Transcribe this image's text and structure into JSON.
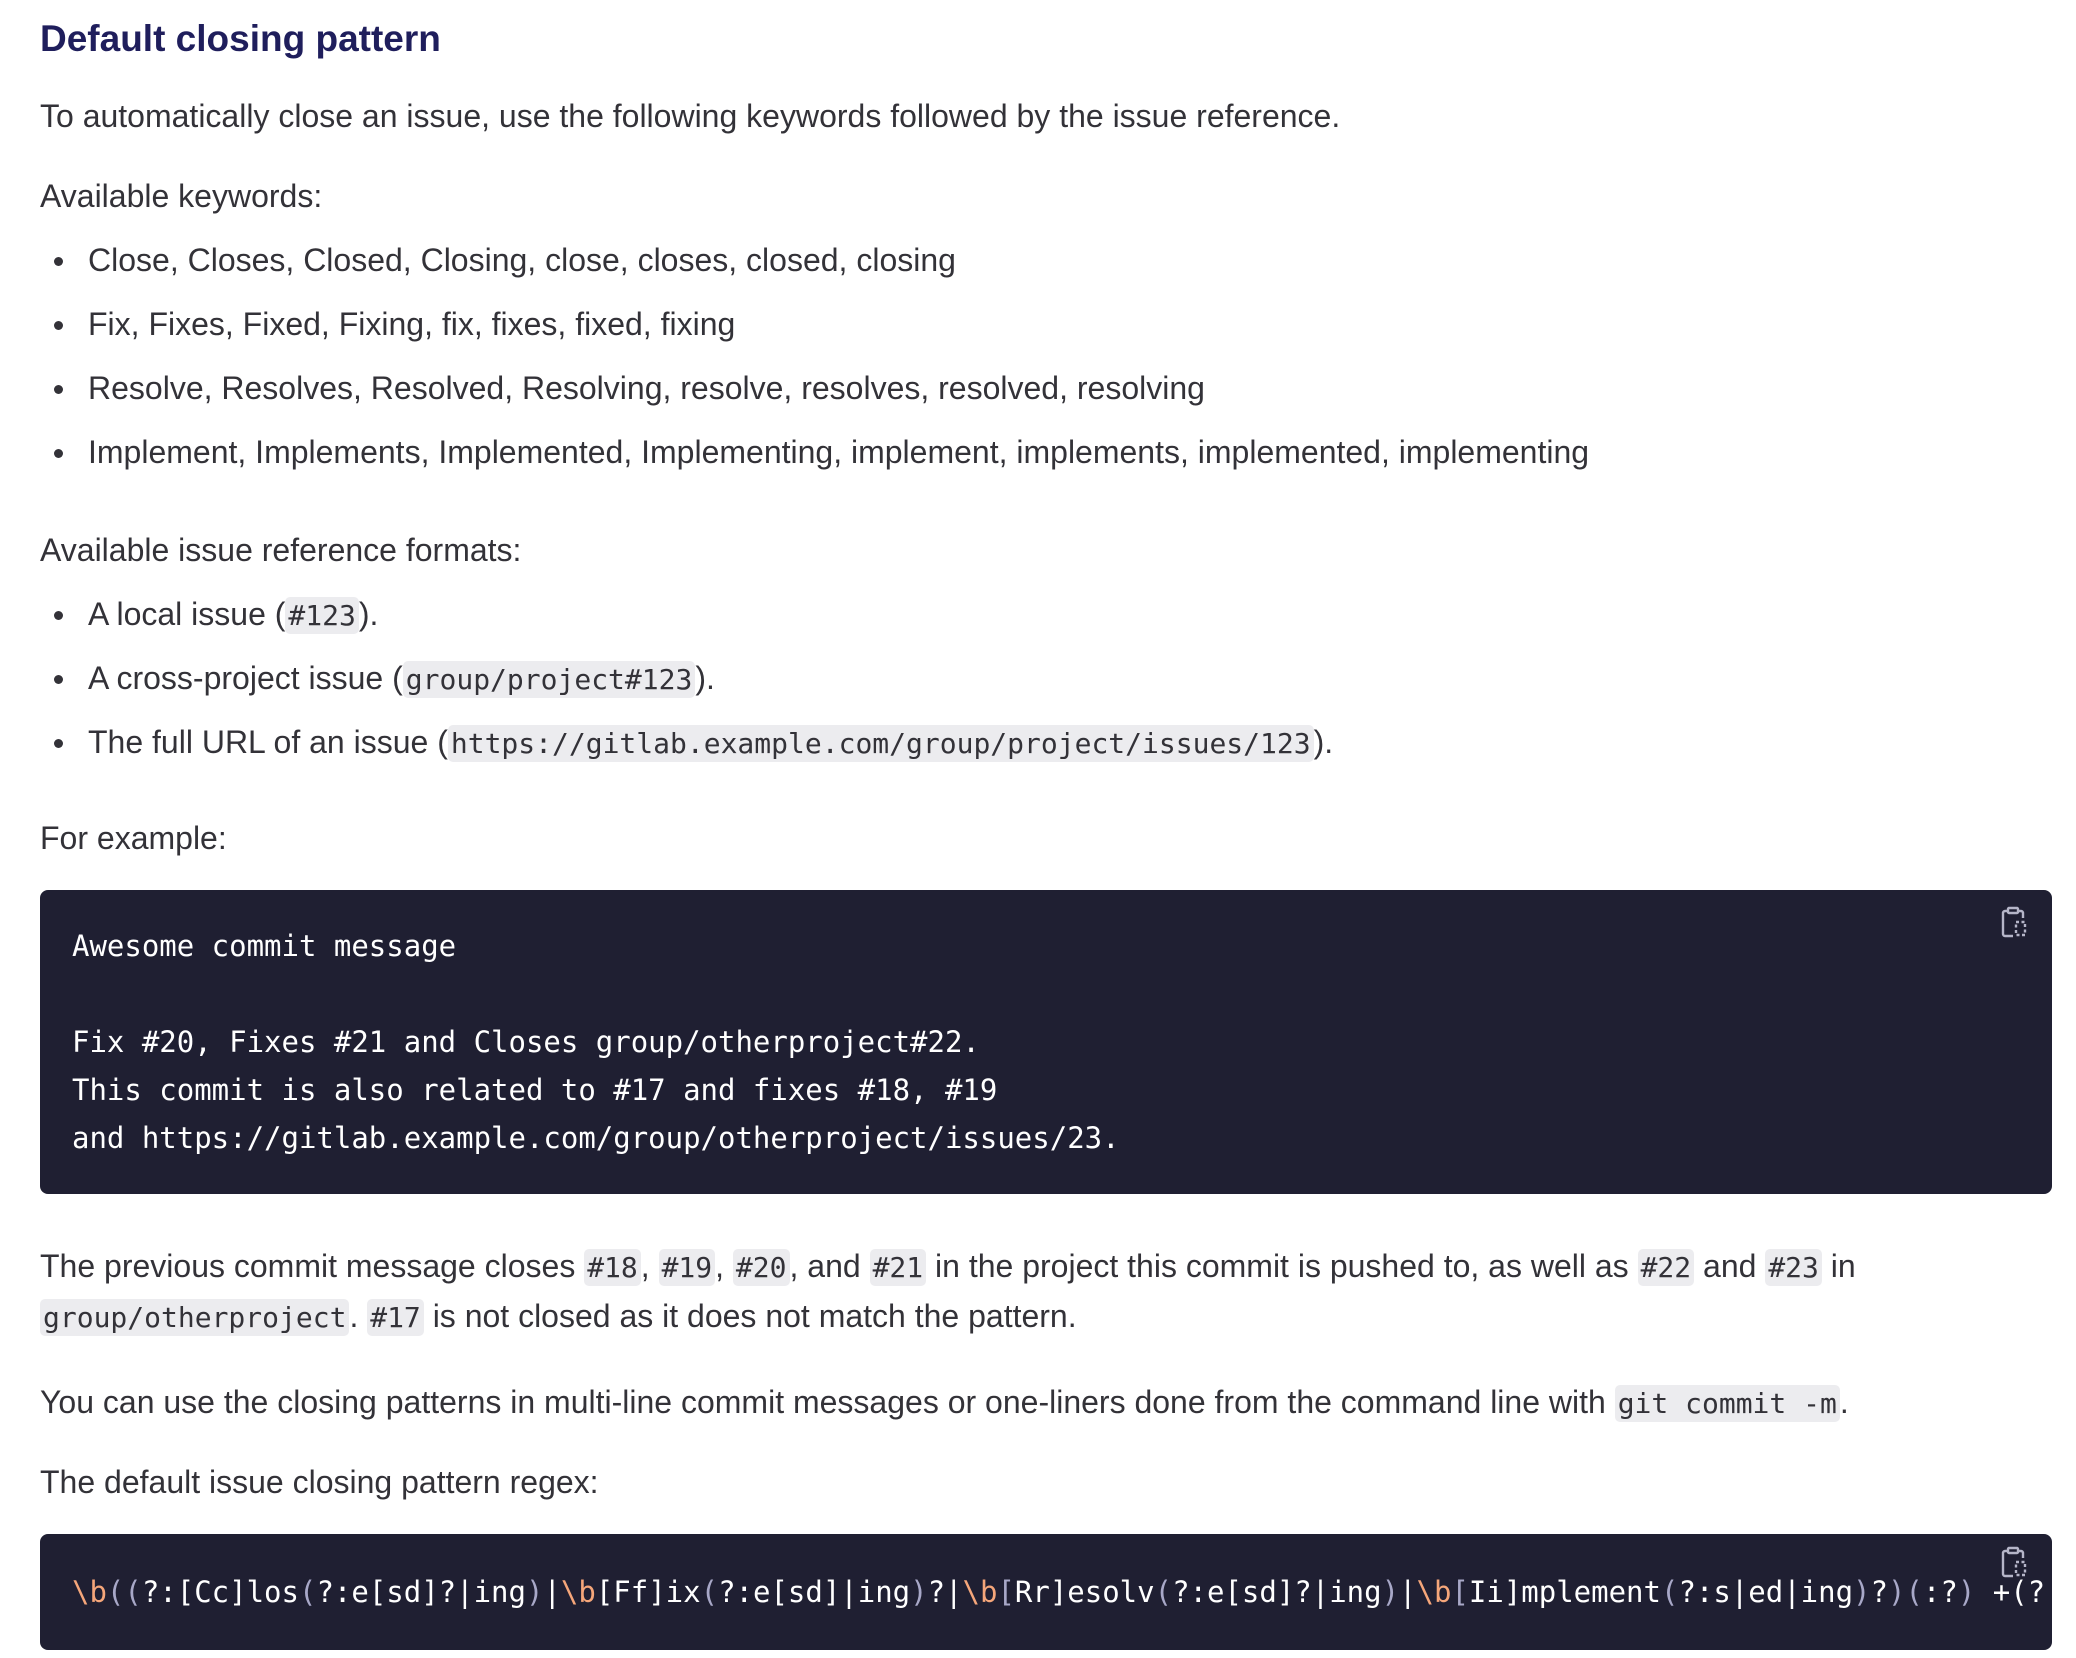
{
  "heading": "Default closing pattern",
  "intro": "To automatically close an issue, use the following keywords followed by the issue reference.",
  "keywords_label": "Available keywords:",
  "keywords": [
    "Close, Closes, Closed, Closing, close, closes, closed, closing",
    "Fix, Fixes, Fixed, Fixing, fix, fixes, fixed, fixing",
    "Resolve, Resolves, Resolved, Resolving, resolve, resolves, resolved, resolving",
    "Implement, Implements, Implemented, Implementing, implement, implements, implemented, implementing"
  ],
  "formats_label": "Available issue reference formats:",
  "formats": [
    {
      "before": "A local issue (",
      "code": "#123",
      "after": ")."
    },
    {
      "before": "A cross-project issue (",
      "code": "group/project#123",
      "after": ")."
    },
    {
      "before": "The full URL of an issue (",
      "code": "https://gitlab.example.com/group/project/issues/123",
      "after": ")."
    }
  ],
  "example_label": "For example:",
  "example_code": "Awesome commit message\n\nFix #20, Fixes #21 and Closes group/otherproject#22.\nThis commit is also related to #17 and fixes #18, #19\nand https://gitlab.example.com/group/otherproject/issues/23.",
  "explain": {
    "t1": "The previous commit message closes ",
    "c18": "#18",
    "sep1": ", ",
    "c19": "#19",
    "sep2": ", ",
    "c20": "#20",
    "sep3": ", and ",
    "c21": "#21",
    "t2": " in the project this commit is pushed to, as well as ",
    "c22": "#22",
    "t3": " and ",
    "c23": "#23",
    "t4": " in",
    "cgroup": "group/otherproject",
    "t5": ". ",
    "c17": "#17",
    "t6": " is not closed as it does not match the pattern."
  },
  "oneliner": {
    "text": "You can use the closing patterns in multi-line commit messages or one-liners done from the command line with ",
    "code": "git commit -m",
    "end": "."
  },
  "regex_label": "The default issue closing pattern regex:",
  "regex_tokens": [
    {
      "t": "\\b",
      "c": "esc"
    },
    {
      "t": "((",
      "c": "br"
    },
    {
      "t": "?:[Cc]los"
    },
    {
      "t": "(",
      "c": "br"
    },
    {
      "t": "?:e[sd]?|ing"
    },
    {
      "t": ")",
      "c": "br"
    },
    {
      "t": "|"
    },
    {
      "t": "\\b",
      "c": "esc"
    },
    {
      "t": "[Ff]ix"
    },
    {
      "t": "(",
      "c": "br"
    },
    {
      "t": "?:e[sd]|ing"
    },
    {
      "t": ")",
      "c": "br"
    },
    {
      "t": "?|"
    },
    {
      "t": "\\b",
      "c": "esc"
    },
    {
      "t": "[",
      "c": "br"
    },
    {
      "t": "Rr]esolv"
    },
    {
      "t": "(",
      "c": "br"
    },
    {
      "t": "?:e[sd]?|ing"
    },
    {
      "t": ")",
      "c": "br"
    },
    {
      "t": "|"
    },
    {
      "t": "\\b",
      "c": "esc"
    },
    {
      "t": "[",
      "c": "br"
    },
    {
      "t": "Ii]mplement"
    },
    {
      "t": "(",
      "c": "br"
    },
    {
      "t": "?:s|ed|ing"
    },
    {
      "t": ")",
      "c": "br"
    },
    {
      "t": "?"
    },
    {
      "t": ")(",
      "c": "br"
    },
    {
      "t": ":?"
    },
    {
      "t": ")",
      "c": "br"
    },
    {
      "t": " +(?:"
    },
    {
      "t": "(",
      "c": "br"
    },
    {
      "t": "?:"
    }
  ],
  "icons": {
    "copy": "copy-to-clipboard-icon"
  },
  "colors": {
    "heading": "#1f1e5c",
    "text": "#333238",
    "code_bg": "#1f1f32",
    "inline_code_bg": "#ececef",
    "regex_escape": "#f5a67a",
    "regex_bracket": "#a8a8c8"
  }
}
